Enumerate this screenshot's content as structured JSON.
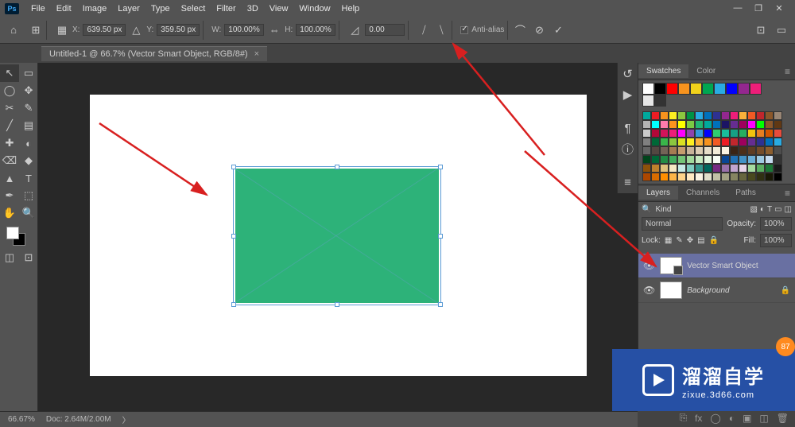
{
  "app": {
    "logo": "Ps"
  },
  "menu": [
    "File",
    "Edit",
    "Image",
    "Layer",
    "Type",
    "Select",
    "Filter",
    "3D",
    "View",
    "Window",
    "Help"
  ],
  "options": {
    "x_label": "X:",
    "x_val": "639.50 px",
    "y_label": "Y:",
    "y_val": "359.50 px",
    "w_label": "W:",
    "w_val": "100.00%",
    "h_label": "H:",
    "h_val": "100.00%",
    "rot_val": "0.00",
    "aa_label": "Anti-alias"
  },
  "doc_tab": "Untitled-1 @ 66.7% (Vector Smart Object, RGB/8#)",
  "tools": [
    "↖",
    "▭",
    "◯",
    "✥",
    "✂",
    "✎",
    "╱",
    "▤",
    "✚",
    "◐",
    "⌫",
    "◆",
    "▲",
    "T",
    "✒",
    "⬚",
    "✋",
    "🔍"
  ],
  "swatches_panel": {
    "tabs": [
      "Swatches",
      "Color"
    ]
  },
  "big_swatches": [
    "#ffffff",
    "#000000",
    "#ff0000",
    "#f7931e",
    "#f1d21b",
    "#00a651",
    "#29abe2",
    "#0000ff",
    "#93278f",
    "#ed1e79",
    "#e6e6e6",
    "#333333"
  ],
  "small_swatches": [
    "#00a99d",
    "#ed1c24",
    "#f7931e",
    "#fcee21",
    "#8cc63f",
    "#009245",
    "#29abe2",
    "#0071bc",
    "#2e3192",
    "#93278f",
    "#ed1e79",
    "#fbb03b",
    "#f15a24",
    "#c1272d",
    "#8b572a",
    "#998675",
    "#b3b3b3",
    "#00ffff",
    "#ff7bac",
    "#ff931e",
    "#ffff00",
    "#7ac943",
    "#22b573",
    "#00a99d",
    "#0071bc",
    "#1b1464",
    "#662d91",
    "#9e005d",
    "#ff00ff",
    "#00ff00",
    "#8b572a",
    "#603813",
    "#cccccc",
    "#b30838",
    "#d4145a",
    "#ed1e79",
    "#ff00ff",
    "#8e44ad",
    "#3498db",
    "#0000ff",
    "#2ecc71",
    "#1abc9c",
    "#16a085",
    "#27ae60",
    "#f1c40f",
    "#e67e22",
    "#d35400",
    "#e74c3c",
    "#808080",
    "#006837",
    "#39b54a",
    "#8cc63f",
    "#d9e021",
    "#fcee21",
    "#fbb03b",
    "#f7931e",
    "#f15a24",
    "#ed1c24",
    "#c1272d",
    "#9e005d",
    "#662d91",
    "#2e3192",
    "#0071bc",
    "#29abe2",
    "#666666",
    "#534741",
    "#736357",
    "#a67c52",
    "#c69c6d",
    "#c7b299",
    "#dbccb4",
    "#e6ddc9",
    "#f2ebd9",
    "#faf3e3",
    "#3a2416",
    "#4b2f1a",
    "#5e3c23",
    "#754c29",
    "#8c5e2e",
    "#4d4d4d",
    "#00441b",
    "#006837",
    "#238b45",
    "#41ab5d",
    "#74c476",
    "#a1d99b",
    "#c7e9c0",
    "#e5f5e0",
    "#f7fcf5",
    "#084594",
    "#2171b5",
    "#4292c6",
    "#6baed6",
    "#9ecae1",
    "#c6dbef",
    "#333333",
    "#8c510a",
    "#bf812d",
    "#dfc27d",
    "#f6e8c3",
    "#c7eae5",
    "#80cdc1",
    "#35978f",
    "#01665e",
    "#762a83",
    "#9970ab",
    "#c2a5cf",
    "#e7d4e8",
    "#a6dba0",
    "#5aae61",
    "#1b7837",
    "#1a1a1a",
    "#ad4700",
    "#d86c00",
    "#ff8f00",
    "#ffb547",
    "#ffd48a",
    "#ffe9c2",
    "#faf3e3",
    "#e0deca",
    "#c2c0a6",
    "#a3a283",
    "#858461",
    "#67663f",
    "#49491e",
    "#303012",
    "#191906",
    "#000000"
  ],
  "layers_panel": {
    "tabs": [
      "Layers",
      "Channels",
      "Paths"
    ],
    "kind": "Kind",
    "blend": "Normal",
    "opacity_label": "Opacity:",
    "opacity": "100%",
    "lock_label": "Lock:",
    "fill_label": "Fill:",
    "fill": "100%",
    "layers": [
      {
        "name": "Vector Smart Object",
        "active": true,
        "smart": true
      },
      {
        "name": "Background",
        "active": false,
        "locked": true
      }
    ]
  },
  "status": {
    "zoom": "66.67%",
    "doc": "Doc: 2.64M/2.00M"
  },
  "watermark": {
    "main": "溜溜自学",
    "sub": "zixue.3d66.com"
  },
  "badge": "87"
}
